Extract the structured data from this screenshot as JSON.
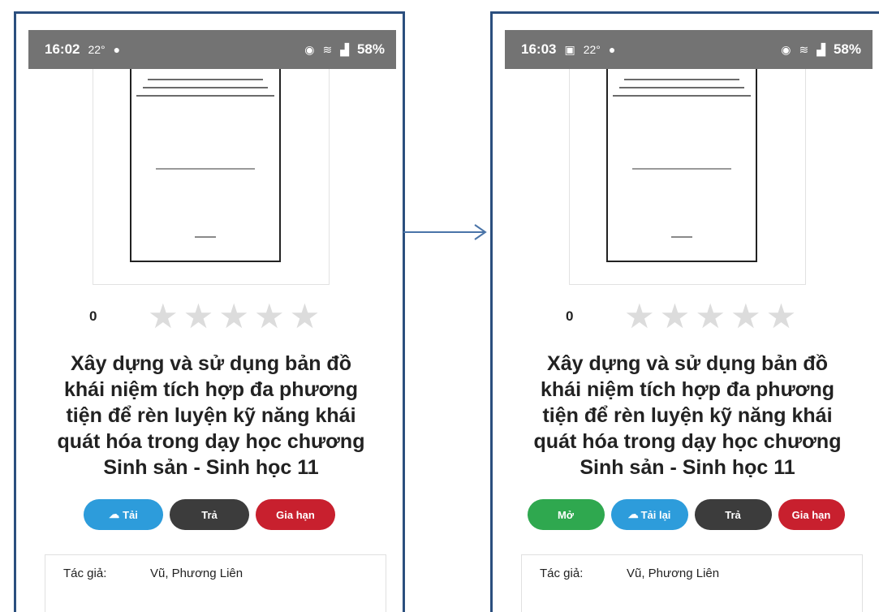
{
  "left": {
    "status_time": "16:02",
    "status_icons_left": [
      "22°",
      "●"
    ],
    "battery": "58%",
    "rating_count": "0",
    "title": "Xây dựng và sử dụng bản đồ khái niệm tích hợp đa phương tiện để rèn luyện kỹ năng khái quát hóa trong dạy học chương Sinh sản - Sinh học 11",
    "buttons": [
      {
        "label": "Tải",
        "color": "#2d9cdb",
        "icon": "cloud-download-icon"
      },
      {
        "label": "Trả",
        "color": "#3c3c3c"
      },
      {
        "label": "Gia hạn",
        "color": "#c8202e"
      }
    ],
    "author_label": "Tác giả:",
    "author_value": "Vũ, Phương Liên"
  },
  "right": {
    "status_time": "16:03",
    "status_icons_left": [
      "▣",
      "22°",
      "●"
    ],
    "battery": "58%",
    "rating_count": "0",
    "title": "Xây dựng và sử dụng bản đồ khái niệm tích hợp đa phương tiện để rèn luyện kỹ năng khái quát hóa trong dạy học chương Sinh sản - Sinh học 11",
    "buttons": [
      {
        "label": "Mở",
        "color": "#2fa84f"
      },
      {
        "label": "Tải lại",
        "color": "#2d9cdb",
        "icon": "cloud-download-icon"
      },
      {
        "label": "Trả",
        "color": "#3c3c3c"
      },
      {
        "label": "Gia hạn",
        "color": "#c8202e"
      }
    ],
    "author_label": "Tác giả:",
    "author_value": "Vũ, Phương Liên"
  },
  "colors": {
    "frame": "#2b4f7e",
    "arrow": "#4a74a8",
    "star_empty": "#dcdcdc"
  }
}
